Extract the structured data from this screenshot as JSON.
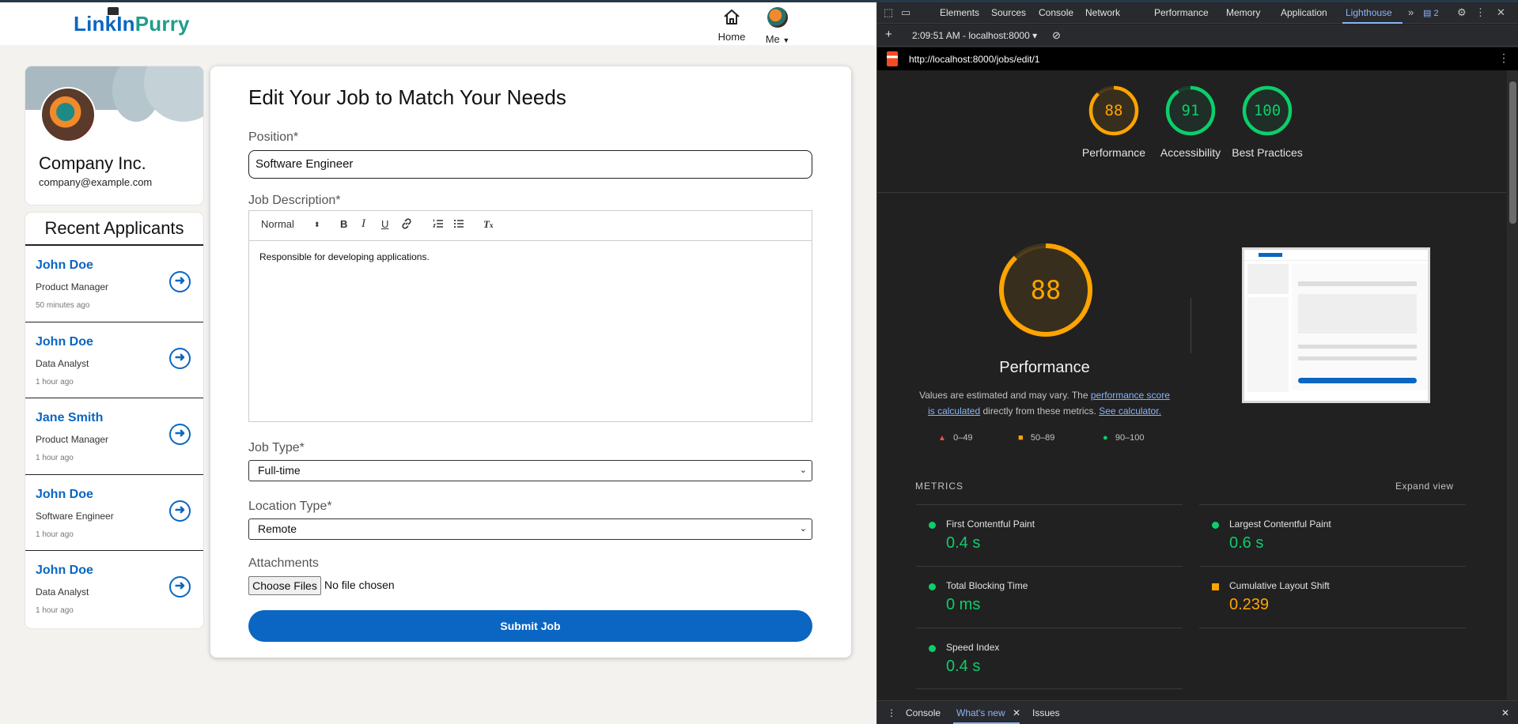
{
  "app": {
    "logo_part1": "LinkIn",
    "logo_part2": "Purry",
    "nav": {
      "home": "Home",
      "me": "Me"
    },
    "profile": {
      "name": "Company Inc.",
      "email": "company@example.com"
    },
    "applicants_title": "Recent Applicants",
    "applicants": [
      {
        "name": "John Doe",
        "role": "Product Manager",
        "time": "50 minutes ago"
      },
      {
        "name": "John Doe",
        "role": "Data Analyst",
        "time": "1 hour ago"
      },
      {
        "name": "Jane Smith",
        "role": "Product Manager",
        "time": "1 hour ago"
      },
      {
        "name": "John Doe",
        "role": "Software Engineer",
        "time": "1 hour ago"
      },
      {
        "name": "John Doe",
        "role": "Data Analyst",
        "time": "1 hour ago"
      }
    ],
    "form": {
      "title": "Edit Your Job to Match Your Needs",
      "position_label": "Position*",
      "position_value": "Software Engineer",
      "description_label": "Job Description*",
      "toolbar_format": "Normal",
      "description_value": "Responsible for developing applications.",
      "job_type_label": "Job Type*",
      "job_type_value": "Full-time",
      "location_type_label": "Location Type*",
      "location_type_value": "Remote",
      "attachments_label": "Attachments",
      "choose_files": "Choose Files",
      "no_file": "No file chosen",
      "submit": "Submit Job"
    }
  },
  "devtools": {
    "tabs": [
      "Elements",
      "Sources",
      "Console",
      "Network",
      "Performance",
      "Memory",
      "Application",
      "Lighthouse"
    ],
    "active_tab": "Lighthouse",
    "issues_badge": "2",
    "report_selector": "2:09:51 AM - localhost:8000",
    "url": "http://localhost:8000/jobs/edit/1",
    "scores": [
      {
        "label": "Performance",
        "value": 88,
        "color": "#ffa400"
      },
      {
        "label": "Accessibility",
        "value": 91,
        "color": "#0cce6b"
      },
      {
        "label": "Best Practices",
        "value": 100,
        "color": "#0cce6b"
      }
    ],
    "perf_title": "Performance",
    "perf_desc_1": "Values are estimated and may vary. The ",
    "perf_desc_link1": "performance score is calculated",
    "perf_desc_2": " directly from these metrics. ",
    "perf_desc_link2": "See calculator.",
    "legend": [
      "0–49",
      "50–89",
      "90–100"
    ],
    "metrics_heading": "METRICS",
    "expand_view": "Expand view",
    "metrics": [
      {
        "name": "First Contentful Paint",
        "value": "0.4 s",
        "status": "good"
      },
      {
        "name": "Largest Contentful Paint",
        "value": "0.6 s",
        "status": "good"
      },
      {
        "name": "Total Blocking Time",
        "value": "0 ms",
        "status": "good"
      },
      {
        "name": "Cumulative Layout Shift",
        "value": "0.239",
        "status": "average"
      },
      {
        "name": "Speed Index",
        "value": "0.4 s",
        "status": "good"
      }
    ],
    "bottom_tabs": [
      "Console",
      "What's new",
      "Issues"
    ]
  }
}
